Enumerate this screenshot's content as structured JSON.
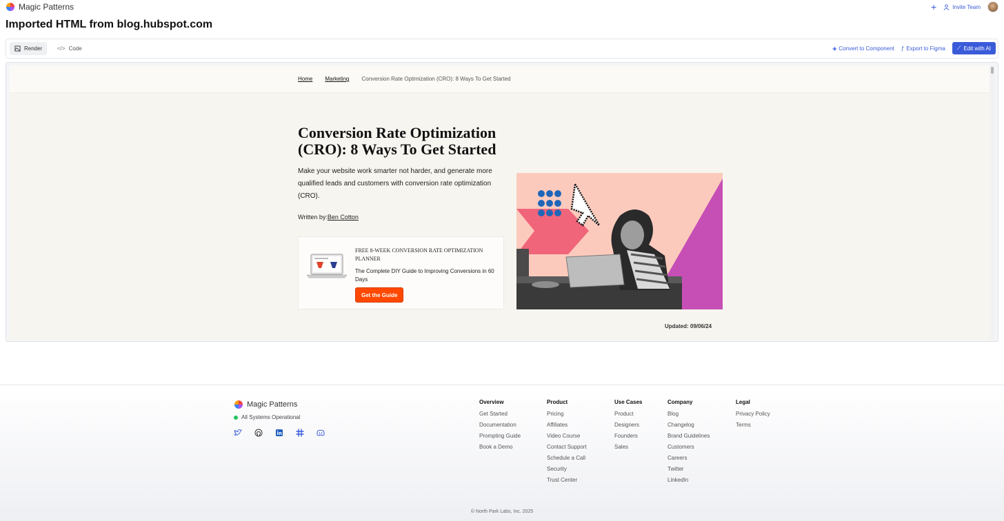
{
  "app": {
    "name": "Magic Patterns",
    "invite": "Invite Team"
  },
  "page": {
    "title": "Imported HTML from blog.hubspot.com"
  },
  "toolbar": {
    "render": "Render",
    "code": "Code",
    "convert": "Convert to Component",
    "export": "Export to Figma",
    "edit": "Edit with AI"
  },
  "preview": {
    "breadcrumbs": {
      "home": "Home",
      "marketing": "Marketing",
      "current": "Conversion Rate Optimization (CRO): 8 Ways To Get Started"
    },
    "title": "Conversion Rate Optimization (CRO): 8 Ways To Get Started",
    "subtitle": "Make your website work smarter not harder, and generate more qualified leads and customers with conversion rate optimization (CRO).",
    "byline_prefix": "Written by:",
    "author": "Ben Cotton",
    "promo": {
      "title": "FREE 8-WEEK CONVERSION RATE OPTIMIZATION PLANNER",
      "description": "The Complete DIY Guide to Improving Conversions in 60 Days",
      "button": "Get the Guide"
    },
    "updated": "Updated: 09/06/24"
  },
  "footer": {
    "brand": "Magic Patterns",
    "status": "All Systems Operational",
    "socials": [
      "twitter-icon",
      "github-icon",
      "linkedin-icon",
      "slack-icon",
      "discord-icon"
    ],
    "columns": [
      {
        "heading": "Overview",
        "links": [
          "Get Started",
          "Documentation",
          "Prompting Guide",
          "Book a Demo"
        ]
      },
      {
        "heading": "Product",
        "links": [
          "Pricing",
          "Affiliates",
          "Video Course",
          "Contact Support",
          "Schedule a Call",
          "Security",
          "Trust Center"
        ]
      },
      {
        "heading": "Use Cases",
        "links": [
          "Product",
          "Designers",
          "Founders",
          "Sales"
        ]
      },
      {
        "heading": "Company",
        "links": [
          "Blog",
          "Changelog",
          "Brand Guidelines",
          "Customers",
          "Careers",
          "Twitter",
          "LinkedIn"
        ]
      },
      {
        "heading": "Legal",
        "links": [
          "Privacy Policy",
          "Terms"
        ]
      }
    ],
    "copyright": "© North Park Labs, Inc. 2025"
  },
  "colors": {
    "accent": "#3a5bd9",
    "cta": "#ff4800",
    "status": "#22c55e"
  }
}
